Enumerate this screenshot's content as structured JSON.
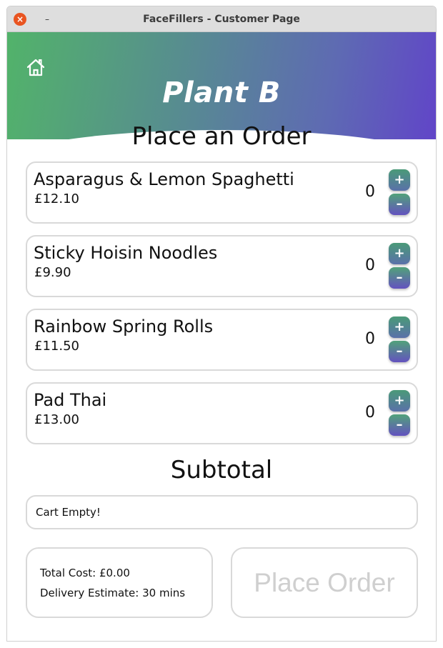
{
  "window": {
    "title": "FaceFillers - Customer Page",
    "close_glyph": "×",
    "minimize_glyph": "–"
  },
  "header": {
    "brand": "Plant B",
    "home_icon": "home-icon",
    "gradient_colors": [
      "#52b36a",
      "#5e6ab3",
      "#6145c8"
    ]
  },
  "order": {
    "title": "Place an Order",
    "items": [
      {
        "name": "Asparagus & Lemon Spaghetti",
        "price": "£12.10",
        "qty": "0",
        "plus": "+",
        "minus": "–"
      },
      {
        "name": "Sticky Hoisin Noodles",
        "price": "£9.90",
        "qty": "0",
        "plus": "+",
        "minus": "–"
      },
      {
        "name": "Rainbow Spring Rolls",
        "price": "£11.50",
        "qty": "0",
        "plus": "+",
        "minus": "–"
      },
      {
        "name": "Pad Thai",
        "price": "£13.00",
        "qty": "0",
        "plus": "+",
        "minus": "–"
      }
    ]
  },
  "subtotal": {
    "title": "Subtotal",
    "cart_text": "Cart Empty!"
  },
  "summary": {
    "total_cost": "Total Cost: £0.00",
    "delivery_estimate": "Delivery Estimate: 30 mins"
  },
  "actions": {
    "place_order": "Place Order"
  }
}
